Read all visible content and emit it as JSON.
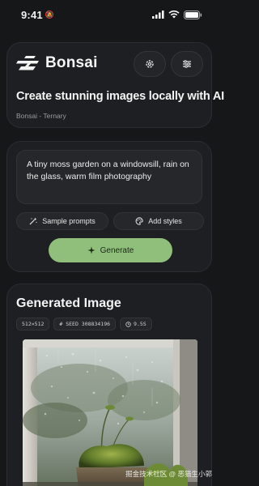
{
  "status_bar": {
    "time": "9:41"
  },
  "header": {
    "brand_name": "Bonsai",
    "headline": "Create stunning images locally with AI",
    "model_label": "Bonsai - Ternary"
  },
  "prompt": {
    "text": "A tiny moss garden on a windowsill, rain on the glass, warm film photography",
    "sample_prompts_label": "Sample prompts",
    "add_styles_label": "Add styles",
    "generate_label": "Generate"
  },
  "result": {
    "title": "Generated Image",
    "chips": {
      "size": "512×512",
      "seed": "# SEED 308834196",
      "guidance": "9.5S"
    }
  },
  "watermark": "掘金技术社区 @ 恶猫生小郭",
  "colors": {
    "background": "#161719",
    "card": "#1e1f22",
    "accent_generate": "#8fbf7a"
  }
}
